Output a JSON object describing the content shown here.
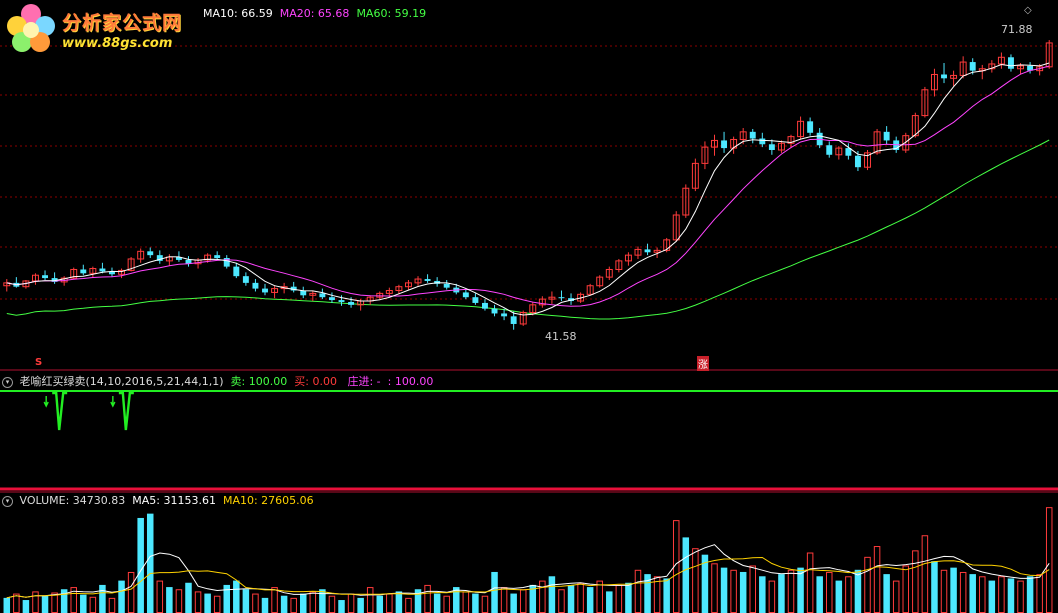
{
  "logo": {
    "title": "分析家公式网",
    "url": "www.88gs.com"
  },
  "main_panel": {
    "ma10": "MA10: 66.59",
    "ma20": "MA20: 65.68",
    "ma60": "MA60: 59.19",
    "high_label": "71.88",
    "low_label": "41.58",
    "mark_left": "S",
    "mark_right": "涨",
    "colors": {
      "ma10": "#ffffff",
      "ma20": "#ff44ff",
      "ma60": "#44ff44",
      "up": "#ff3b3b",
      "down": "#4de8ff",
      "grid": "#8b0000"
    }
  },
  "indicator_panel": {
    "name": "老喻红买绿卖(14,10,2016,5,21,44,1,1)",
    "sell": "卖: 100.00",
    "buy": "买: 0.00",
    "zhuang": "庄进: -",
    "zhuang_value": ": 100.00"
  },
  "volume_panel": {
    "volume": "VOLUME: 34730.83",
    "ma5": "MA5: 31153.61",
    "ma10": "MA10: 27605.06"
  },
  "chart_data": {
    "type": "candlestick",
    "price_range": [
      40,
      74
    ],
    "candles": [
      [
        46.2,
        46.9,
        45.6,
        46.5
      ],
      [
        46.5,
        47.1,
        46.0,
        46.1
      ],
      [
        46.1,
        46.8,
        45.9,
        46.7
      ],
      [
        46.7,
        47.5,
        46.3,
        47.3
      ],
      [
        47.3,
        47.8,
        46.8,
        47.0
      ],
      [
        47.0,
        47.6,
        46.4,
        46.6
      ],
      [
        46.6,
        47.2,
        46.2,
        47.0
      ],
      [
        47.0,
        48.1,
        46.9,
        47.9
      ],
      [
        47.9,
        48.4,
        47.3,
        47.5
      ],
      [
        47.5,
        48.2,
        47.1,
        48.0
      ],
      [
        48.0,
        48.6,
        47.5,
        47.7
      ],
      [
        47.7,
        48.1,
        47.1,
        47.4
      ],
      [
        47.4,
        48.0,
        47.0,
        47.8
      ],
      [
        47.8,
        49.2,
        47.7,
        49.0
      ],
      [
        49.0,
        50.1,
        48.6,
        49.8
      ],
      [
        49.8,
        50.2,
        49.1,
        49.4
      ],
      [
        49.4,
        49.9,
        48.5,
        48.8
      ],
      [
        48.8,
        49.5,
        48.3,
        49.2
      ],
      [
        49.2,
        49.8,
        48.7,
        48.9
      ],
      [
        48.9,
        49.3,
        48.2,
        48.5
      ],
      [
        48.5,
        49.1,
        48.0,
        48.9
      ],
      [
        48.9,
        49.6,
        48.6,
        49.4
      ],
      [
        49.4,
        49.8,
        48.9,
        49.1
      ],
      [
        49.1,
        49.4,
        48.0,
        48.2
      ],
      [
        48.2,
        48.6,
        47.0,
        47.2
      ],
      [
        47.2,
        47.6,
        46.2,
        46.5
      ],
      [
        46.5,
        46.9,
        45.6,
        45.9
      ],
      [
        45.9,
        46.4,
        45.2,
        45.5
      ],
      [
        45.5,
        46.2,
        44.9,
        45.9
      ],
      [
        45.9,
        46.5,
        45.4,
        46.1
      ],
      [
        46.1,
        46.6,
        45.5,
        45.7
      ],
      [
        45.7,
        46.1,
        44.9,
        45.2
      ],
      [
        45.2,
        45.7,
        44.6,
        45.4
      ],
      [
        45.4,
        45.9,
        44.8,
        45.0
      ],
      [
        45.0,
        45.5,
        44.4,
        44.7
      ],
      [
        44.7,
        45.2,
        44.1,
        44.5
      ],
      [
        44.5,
        45.0,
        43.9,
        44.2
      ],
      [
        44.2,
        44.8,
        43.6,
        44.6
      ],
      [
        44.6,
        45.2,
        44.2,
        45.0
      ],
      [
        45.0,
        45.6,
        44.7,
        45.4
      ],
      [
        45.4,
        46.0,
        45.0,
        45.7
      ],
      [
        45.7,
        46.3,
        45.3,
        46.1
      ],
      [
        46.1,
        46.8,
        45.8,
        46.5
      ],
      [
        46.5,
        47.2,
        46.2,
        46.9
      ],
      [
        46.9,
        47.4,
        46.5,
        46.7
      ],
      [
        46.7,
        47.1,
        46.1,
        46.4
      ],
      [
        46.4,
        46.8,
        45.8,
        46.0
      ],
      [
        46.0,
        46.4,
        45.3,
        45.5
      ],
      [
        45.5,
        45.9,
        44.8,
        45.0
      ],
      [
        45.0,
        45.4,
        44.2,
        44.4
      ],
      [
        44.4,
        44.8,
        43.6,
        43.8
      ],
      [
        43.8,
        44.2,
        43.0,
        43.3
      ],
      [
        43.3,
        43.8,
        42.6,
        43.0
      ],
      [
        43.0,
        43.5,
        41.6,
        42.2
      ],
      [
        42.2,
        43.6,
        42.0,
        43.4
      ],
      [
        43.4,
        44.5,
        43.1,
        44.2
      ],
      [
        44.2,
        45.1,
        43.9,
        44.8
      ],
      [
        44.8,
        45.6,
        44.3,
        45.0
      ],
      [
        45.0,
        45.7,
        44.6,
        44.9
      ],
      [
        44.9,
        45.4,
        44.2,
        44.6
      ],
      [
        44.6,
        45.5,
        44.4,
        45.3
      ],
      [
        45.3,
        46.4,
        45.2,
        46.2
      ],
      [
        46.2,
        47.3,
        46.0,
        47.1
      ],
      [
        47.1,
        48.2,
        46.8,
        47.9
      ],
      [
        47.9,
        49.0,
        47.6,
        48.8
      ],
      [
        48.8,
        49.7,
        48.3,
        49.4
      ],
      [
        49.4,
        50.3,
        49.0,
        50.0
      ],
      [
        50.0,
        50.6,
        49.4,
        49.7
      ],
      [
        49.7,
        50.2,
        49.1,
        49.9
      ],
      [
        49.9,
        51.2,
        49.7,
        51.0
      ],
      [
        51.0,
        54.0,
        50.8,
        53.6
      ],
      [
        53.6,
        56.8,
        53.3,
        56.4
      ],
      [
        56.4,
        59.5,
        56.1,
        59.0
      ],
      [
        59.0,
        61.3,
        58.4,
        60.7
      ],
      [
        60.7,
        62.0,
        59.8,
        61.4
      ],
      [
        61.4,
        62.3,
        60.1,
        60.6
      ],
      [
        60.6,
        61.8,
        60.0,
        61.5
      ],
      [
        61.5,
        62.7,
        61.0,
        62.3
      ],
      [
        62.3,
        62.6,
        61.1,
        61.6
      ],
      [
        61.6,
        62.2,
        60.7,
        61.0
      ],
      [
        61.0,
        61.5,
        59.9,
        60.4
      ],
      [
        60.4,
        61.4,
        60.1,
        61.1
      ],
      [
        61.1,
        62.0,
        60.6,
        61.8
      ],
      [
        61.8,
        63.9,
        61.5,
        63.4
      ],
      [
        63.4,
        63.8,
        61.9,
        62.2
      ],
      [
        62.2,
        62.7,
        60.6,
        60.9
      ],
      [
        60.9,
        61.3,
        59.6,
        59.9
      ],
      [
        59.9,
        60.8,
        59.4,
        60.6
      ],
      [
        60.6,
        61.1,
        59.4,
        59.8
      ],
      [
        59.8,
        60.3,
        58.2,
        58.6
      ],
      [
        58.6,
        60.4,
        58.3,
        60.1
      ],
      [
        60.1,
        62.6,
        59.9,
        62.3
      ],
      [
        62.3,
        62.9,
        61.0,
        61.4
      ],
      [
        61.4,
        61.8,
        60.1,
        60.4
      ],
      [
        60.4,
        62.2,
        60.1,
        61.9
      ],
      [
        61.9,
        64.3,
        61.7,
        64.0
      ],
      [
        64.0,
        67.0,
        63.8,
        66.7
      ],
      [
        66.7,
        68.9,
        66.0,
        68.3
      ],
      [
        68.3,
        69.5,
        67.4,
        67.9
      ],
      [
        67.9,
        68.7,
        67.1,
        68.2
      ],
      [
        68.2,
        70.2,
        67.9,
        69.6
      ],
      [
        69.6,
        70.0,
        68.3,
        68.7
      ],
      [
        68.7,
        69.3,
        67.8,
        68.9
      ],
      [
        68.9,
        69.8,
        68.5,
        69.4
      ],
      [
        69.4,
        70.6,
        68.9,
        70.1
      ],
      [
        70.1,
        70.4,
        68.6,
        68.9
      ],
      [
        68.9,
        69.5,
        68.3,
        69.2
      ],
      [
        69.2,
        69.6,
        68.4,
        68.7
      ],
      [
        68.7,
        69.4,
        68.2,
        69.1
      ],
      [
        69.1,
        71.9,
        68.9,
        71.6
      ]
    ],
    "volume": [
      [
        "d",
        14
      ],
      [
        "u",
        18
      ],
      [
        "d",
        12
      ],
      [
        "u",
        20
      ],
      [
        "d",
        16
      ],
      [
        "u",
        19
      ],
      [
        "d",
        22
      ],
      [
        "u",
        24
      ],
      [
        "d",
        17
      ],
      [
        "u",
        15
      ],
      [
        "d",
        26
      ],
      [
        "u",
        14
      ],
      [
        "d",
        30
      ],
      [
        "u",
        38
      ],
      [
        "d",
        88
      ],
      [
        "d",
        92
      ],
      [
        "u",
        30
      ],
      [
        "d",
        24
      ],
      [
        "u",
        22
      ],
      [
        "d",
        28
      ],
      [
        "u",
        20
      ],
      [
        "d",
        18
      ],
      [
        "u",
        16
      ],
      [
        "d",
        26
      ],
      [
        "d",
        30
      ],
      [
        "d",
        22
      ],
      [
        "u",
        18
      ],
      [
        "d",
        14
      ],
      [
        "u",
        24
      ],
      [
        "d",
        16
      ],
      [
        "u",
        14
      ],
      [
        "d",
        18
      ],
      [
        "u",
        20
      ],
      [
        "d",
        22
      ],
      [
        "u",
        16
      ],
      [
        "d",
        12
      ],
      [
        "u",
        18
      ],
      [
        "d",
        14
      ],
      [
        "u",
        24
      ],
      [
        "d",
        16
      ],
      [
        "u",
        18
      ],
      [
        "d",
        20
      ],
      [
        "u",
        14
      ],
      [
        "d",
        22
      ],
      [
        "u",
        26
      ],
      [
        "d",
        18
      ],
      [
        "u",
        16
      ],
      [
        "d",
        24
      ],
      [
        "u",
        20
      ],
      [
        "d",
        18
      ],
      [
        "u",
        16
      ],
      [
        "d",
        38
      ],
      [
        "u",
        24
      ],
      [
        "d",
        18
      ],
      [
        "u",
        22
      ],
      [
        "d",
        26
      ],
      [
        "u",
        30
      ],
      [
        "d",
        34
      ],
      [
        "u",
        22
      ],
      [
        "d",
        26
      ],
      [
        "u",
        28
      ],
      [
        "d",
        24
      ],
      [
        "u",
        30
      ],
      [
        "d",
        20
      ],
      [
        "u",
        26
      ],
      [
        "d",
        28
      ],
      [
        "u",
        40
      ],
      [
        "d",
        36
      ],
      [
        "u",
        34
      ],
      [
        "d",
        32
      ],
      [
        "u",
        86
      ],
      [
        "d",
        70
      ],
      [
        "u",
        60
      ],
      [
        "d",
        54
      ],
      [
        "u",
        46
      ],
      [
        "d",
        42
      ],
      [
        "u",
        40
      ],
      [
        "d",
        38
      ],
      [
        "u",
        44
      ],
      [
        "d",
        34
      ],
      [
        "u",
        30
      ],
      [
        "d",
        36
      ],
      [
        "u",
        40
      ],
      [
        "d",
        42
      ],
      [
        "u",
        56
      ],
      [
        "d",
        34
      ],
      [
        "u",
        38
      ],
      [
        "d",
        30
      ],
      [
        "u",
        34
      ],
      [
        "d",
        40
      ],
      [
        "u",
        52
      ],
      [
        "u",
        62
      ],
      [
        "d",
        36
      ],
      [
        "u",
        30
      ],
      [
        "u",
        44
      ],
      [
        "u",
        58
      ],
      [
        "u",
        72
      ],
      [
        "d",
        48
      ],
      [
        "u",
        40
      ],
      [
        "d",
        42
      ],
      [
        "u",
        38
      ],
      [
        "d",
        36
      ],
      [
        "u",
        34
      ],
      [
        "d",
        30
      ],
      [
        "u",
        34
      ],
      [
        "d",
        32
      ],
      [
        "u",
        30
      ],
      [
        "d",
        34
      ],
      [
        "u",
        36
      ],
      [
        "u",
        98
      ]
    ],
    "signals": [
      {
        "x": 0.055,
        "kind": "sell"
      },
      {
        "x": 0.118,
        "kind": "sell"
      }
    ]
  }
}
